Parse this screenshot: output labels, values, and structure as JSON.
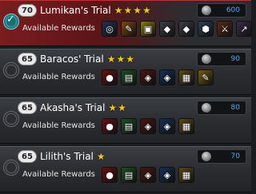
{
  "trials": [
    {
      "level": "70",
      "name": "Lumikan's Trial",
      "stars": "★★★★",
      "rewards_label": "Available Rewards",
      "cost": "600",
      "selected": true,
      "items": [
        {
          "icon": "ring-icon",
          "bg": "#23304f",
          "glyph": "◎"
        },
        {
          "icon": "scroll-icon",
          "bg": "#7a4a12",
          "glyph": "✎"
        },
        {
          "icon": "gold-chest-icon",
          "bg": "#8c7a10",
          "glyph": "▣"
        },
        {
          "icon": "ore-icon",
          "bg": "#3b3f46",
          "glyph": "◆"
        },
        {
          "icon": "ore-icon",
          "bg": "#3b3f46",
          "glyph": "◆"
        },
        {
          "icon": "shield-icon",
          "bg": "#2e3f55",
          "glyph": "⬢"
        },
        {
          "icon": "sword-icon",
          "bg": "#5a2a12",
          "glyph": "⚔"
        },
        {
          "icon": "spear-icon",
          "bg": "#3a2a4a",
          "glyph": "↗"
        }
      ]
    },
    {
      "level": "65",
      "name": "Baracos' Trial",
      "stars": "★★★",
      "rewards_label": "Available Rewards",
      "cost": "90",
      "selected": false,
      "items": [
        {
          "icon": "red-potion-icon",
          "bg": "#6a1010",
          "glyph": "●"
        },
        {
          "icon": "green-book-icon",
          "bg": "#1f4f22",
          "glyph": "▤"
        },
        {
          "icon": "red-material-icon",
          "bg": "#4a1510",
          "glyph": "◈"
        },
        {
          "icon": "blue-material-icon",
          "bg": "#162f55",
          "glyph": "◈"
        },
        {
          "icon": "map-icon",
          "bg": "#5a4a18",
          "glyph": "▦"
        },
        {
          "icon": "gold-scroll-icon",
          "bg": "#7a5a12",
          "glyph": "✎"
        }
      ]
    },
    {
      "level": "65",
      "name": "Akasha's Trial",
      "stars": "★★",
      "rewards_label": "Available Rewards",
      "cost": "80",
      "selected": false,
      "items": [
        {
          "icon": "red-potion-icon",
          "bg": "#6a1010",
          "glyph": "●"
        },
        {
          "icon": "green-book-icon",
          "bg": "#1f4f22",
          "glyph": "▤"
        },
        {
          "icon": "red-material-icon",
          "bg": "#4a1510",
          "glyph": "◈"
        },
        {
          "icon": "blue-material-icon",
          "bg": "#162f55",
          "glyph": "◈"
        },
        {
          "icon": "map-icon",
          "bg": "#5a4a18",
          "glyph": "▦"
        }
      ]
    },
    {
      "level": "65",
      "name": "Lilith's Trial",
      "stars": "★",
      "rewards_label": "Available Rewards",
      "cost": "70",
      "selected": false,
      "items": [
        {
          "icon": "red-potion-icon",
          "bg": "#6a1010",
          "glyph": "●"
        },
        {
          "icon": "green-book-icon",
          "bg": "#1f4f22",
          "glyph": "▤"
        },
        {
          "icon": "red-material-icon",
          "bg": "#4a1510",
          "glyph": "◈"
        },
        {
          "icon": "blue-material-icon",
          "bg": "#162f55",
          "glyph": "◈"
        },
        {
          "icon": "map-icon",
          "bg": "#5a4a18",
          "glyph": "▦"
        }
      ]
    }
  ],
  "colors": {
    "star": "#f3c419",
    "cost": "#5da7e8",
    "active_card": "#7a1d1f"
  }
}
